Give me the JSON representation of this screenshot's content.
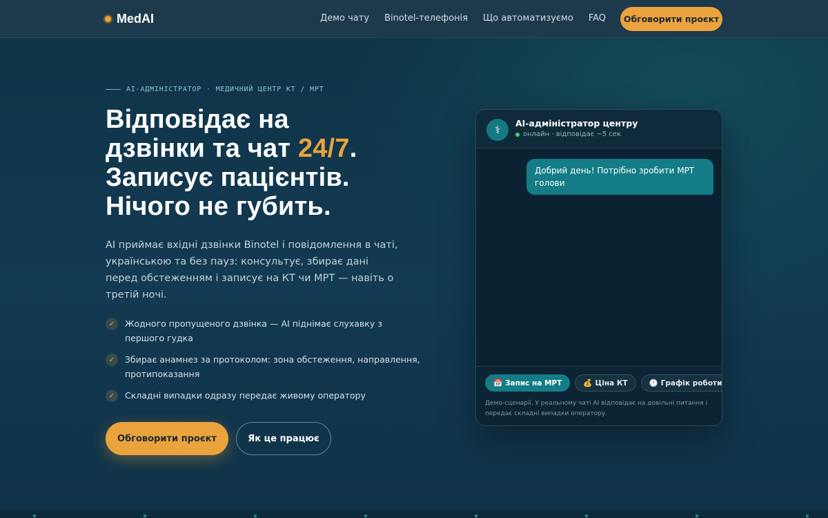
{
  "nav": {
    "brand": "MedAI",
    "links": [
      "Демо чату",
      "Binotel-телефонія",
      "Що автоматизуємо",
      "FAQ"
    ],
    "cta": "Обговорити проєкт"
  },
  "hero": {
    "eyebrow": "AI-АДМІНІСТРАТОР · МЕДИЧНИЙ ЦЕНТР КТ / МРТ",
    "headline_1": "Відповідає на",
    "headline_2": "дзвінки та чат",
    "headline_accent": "24/7",
    "headline_dot": ".",
    "headline_3": "Записує пацієнтів.",
    "headline_4": "Нічого не губить.",
    "lead": "AI приймає вхідні дзвінки Binotel і повідомлення в чаті, українською та без пауз: консультує, збирає дані перед обстеженням і записує на КТ чи МРТ — навіть о третій ночі.",
    "checks": [
      "Жодного пропущеного дзвінка — AI піднімає слухавку з першого гудка",
      "Збирає анамнез за протоколом: зона обстеження, направлення, протипоказання",
      "Складні випадки одразу передає живому оператору"
    ],
    "check_icon": "✓",
    "btn_primary": "Обговорити проєкт",
    "btn_secondary": "Як це працює"
  },
  "chat": {
    "avatar_icon": "⚕",
    "title": "AI-адміністратор центру",
    "status": "онлайн · відповідає ~5 сек",
    "status_color": "#3ed67a",
    "user_message": "Добрий день! Потрібно зробити МРТ голови",
    "chips": [
      {
        "icon": "📅",
        "label": "Запис на МРТ"
      },
      {
        "icon": "💰",
        "label": "Ціна КТ"
      },
      {
        "icon": "🕐",
        "label": "Графік роботи"
      }
    ],
    "note": "Демо-сценарії. У реальному чаті AI відповідає на довільні питання і передає складні випадки оператору."
  },
  "colors": {
    "accent": "#eba33e",
    "teal": "#137c86"
  }
}
